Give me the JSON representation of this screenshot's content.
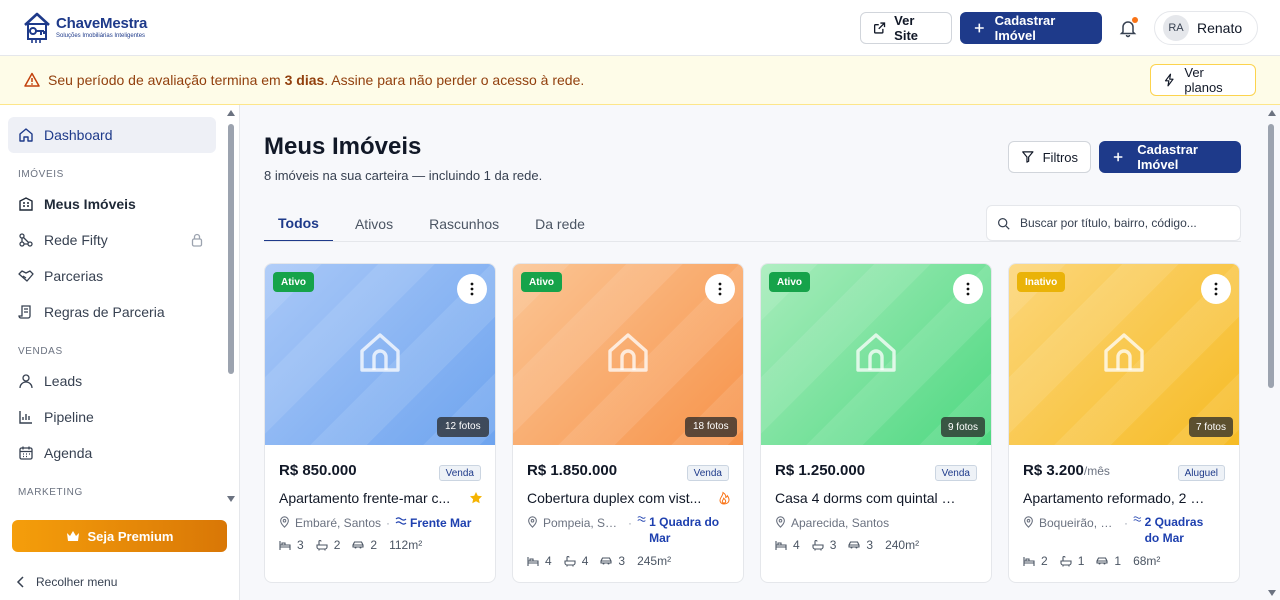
{
  "brand": {
    "name": "ChaveMestra",
    "tagline": "Soluções Imobiliárias Inteligentes"
  },
  "header": {
    "view_site": "Ver Site",
    "register_property": "Cadastrar Imóvel",
    "user": {
      "initials": "RA",
      "name": "Renato"
    }
  },
  "banner": {
    "text_before": "Seu período de avaliação termina em ",
    "days": "3 dias",
    "text_after": ". Assine para não perder o acesso à rede.",
    "plans_button": "Ver planos"
  },
  "sidebar": {
    "dashboard": "Dashboard",
    "section_properties": "IMÓVEIS",
    "my_properties": "Meus Imóveis",
    "network": "Rede Fifty",
    "partnerships": "Parcerias",
    "partnership_rules": "Regras de Parceria",
    "section_sales": "VENDAS",
    "leads": "Leads",
    "pipeline": "Pipeline",
    "agenda": "Agenda",
    "section_marketing": "MARKETING",
    "premium": "Seja Premium",
    "collapse": "Recolher menu"
  },
  "main": {
    "title": "Meus Imóveis",
    "subtitle": "8 imóveis na sua carteira — incluindo 1 da rede.",
    "filters": "Filtros",
    "register": "Cadastrar Imóvel",
    "tabs": [
      "Todos",
      "Ativos",
      "Rascunhos",
      "Da rede"
    ],
    "search_placeholder": "Buscar por título, bairro, código..."
  },
  "cards": [
    {
      "status": "Ativo",
      "photos": "12 fotos",
      "price": "R$ 850.000",
      "price_suffix": "",
      "kind": "Venda",
      "title": "Apartamento frente-mar c...",
      "flag": "star",
      "neighborhood": "Embaré, Santos",
      "highlight": "Frente Mar",
      "beds": "3",
      "baths": "2",
      "parking": "2",
      "area": "112m²",
      "colors": [
        "#a9c8f7",
        "#6ea4ef"
      ],
      "status_color": "#16a34a"
    },
    {
      "status": "Ativo",
      "photos": "18 fotos",
      "price": "R$ 1.850.000",
      "price_suffix": "",
      "kind": "Venda",
      "title": "Cobertura duplex com vist...",
      "flag": "fire",
      "neighborhood": "Pompeia, San...",
      "highlight": "1 Quadra do Mar",
      "beds": "4",
      "baths": "4",
      "parking": "3",
      "area": "245m²",
      "colors": [
        "#fbc594",
        "#f7934a"
      ],
      "status_color": "#16a34a"
    },
    {
      "status": "Ativo",
      "photos": "9 fotos",
      "price": "R$ 1.250.000",
      "price_suffix": "",
      "kind": "Venda",
      "title": "Casa 4 dorms com quintal — ...",
      "flag": "",
      "neighborhood": "Aparecida, Santos",
      "highlight": "",
      "beds": "4",
      "baths": "3",
      "parking": "3",
      "area": "240m²",
      "colors": [
        "#a7ecbb",
        "#4ed881"
      ],
      "status_color": "#16a34a"
    },
    {
      "status": "Inativo",
      "photos": "7 fotos",
      "price": "R$ 3.200",
      "price_suffix": "/mês",
      "kind": "Aluguel",
      "title": "Apartamento reformado, 2 do...",
      "flag": "",
      "neighborhood": "Boqueirão, Sa...",
      "highlight": "2 Quadras do Mar",
      "beds": "2",
      "baths": "1",
      "parking": "1",
      "area": "68m²",
      "colors": [
        "#fcd67a",
        "#f6bb24"
      ],
      "status_color": "#eab308"
    }
  ]
}
